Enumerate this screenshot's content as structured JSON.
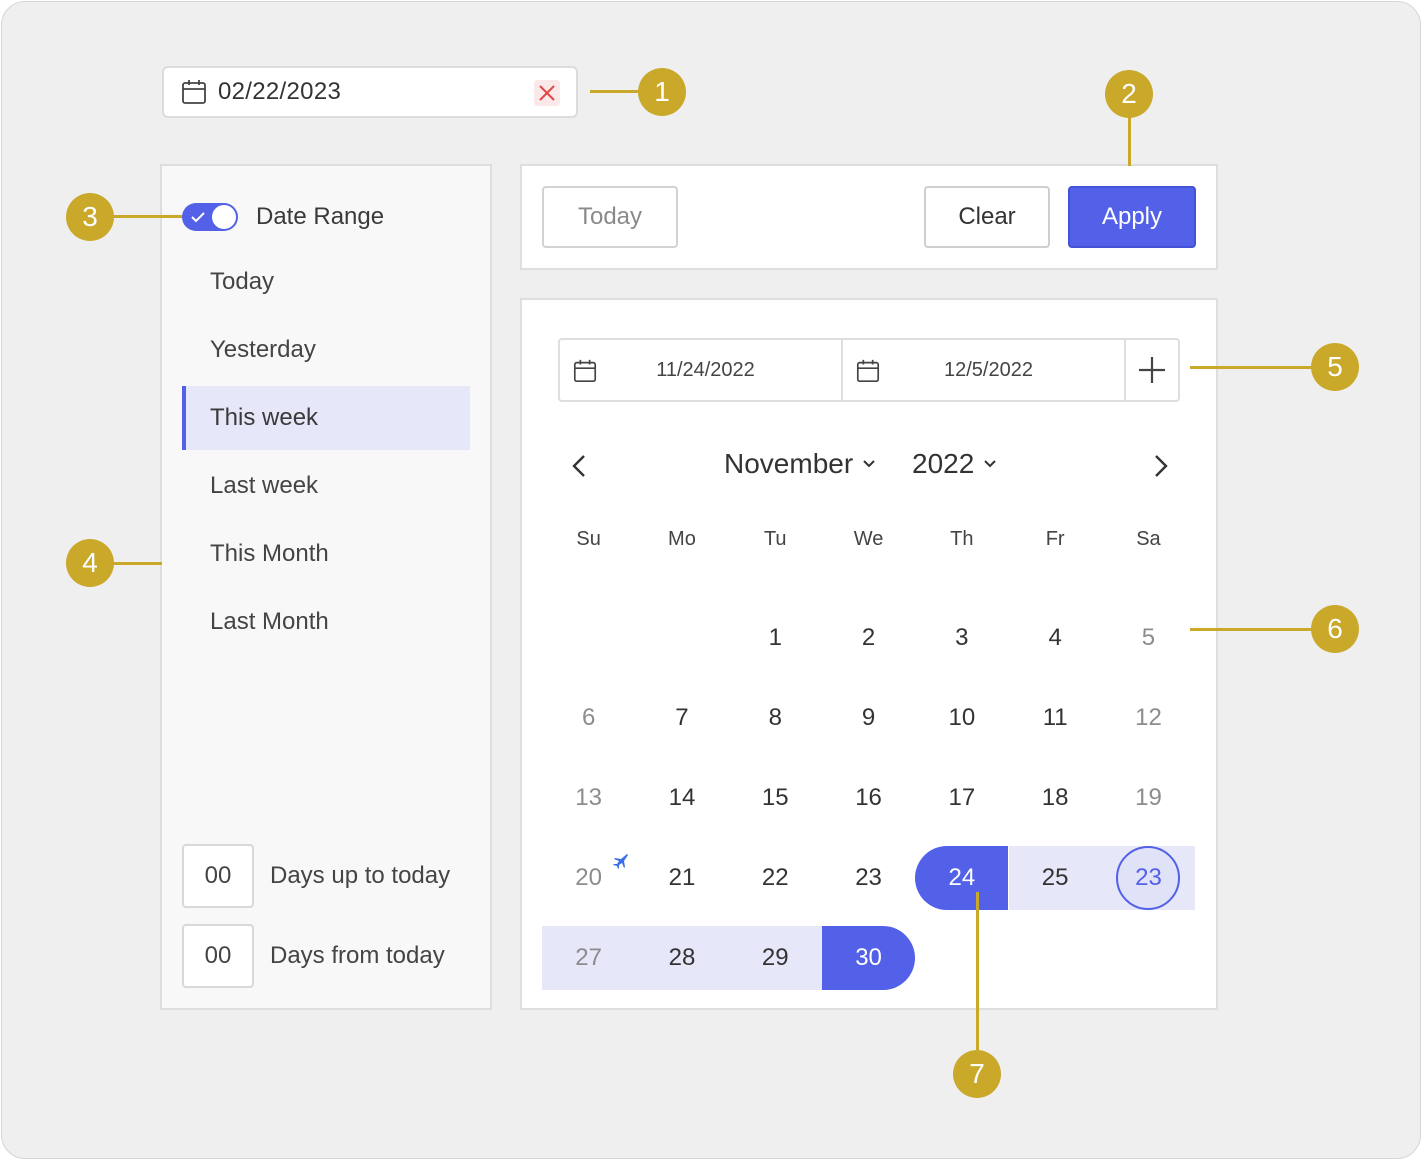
{
  "date_input": {
    "value": "02/22/2023",
    "icon": "calendar-icon",
    "clear_icon": "close-icon"
  },
  "sidebar": {
    "toggle_label": "Date Range",
    "toggle_on": true,
    "items": [
      {
        "label": "Today",
        "active": false
      },
      {
        "label": "Yesterday",
        "active": false
      },
      {
        "label": "This week",
        "active": true
      },
      {
        "label": "Last week",
        "active": false
      },
      {
        "label": "This Month",
        "active": false
      },
      {
        "label": "Last Month",
        "active": false
      }
    ],
    "days_up": {
      "value": "00",
      "label": "Days up to today"
    },
    "days_from": {
      "value": "00",
      "label": "Days from today"
    }
  },
  "actions": {
    "today": "Today",
    "clear": "Clear",
    "apply": "Apply"
  },
  "range": {
    "start": "11/24/2022",
    "end": "12/5/2022",
    "add_icon": "plus-icon"
  },
  "calendar": {
    "month": "November",
    "year": "2022",
    "weekdays": [
      "Su",
      "Mo",
      "Tu",
      "We",
      "Th",
      "Fr",
      "Sa"
    ],
    "weeks": [
      [
        "",
        "",
        "1",
        "2",
        "3",
        "4",
        "5"
      ],
      [
        "6",
        "7",
        "8",
        "9",
        "10",
        "11",
        "12"
      ],
      [
        "13",
        "14",
        "15",
        "16",
        "17",
        "18",
        "19"
      ],
      [
        "20",
        "21",
        "22",
        "23",
        "24",
        "25",
        "23"
      ],
      [
        "27",
        "28",
        "29",
        "30",
        "",
        "",
        ""
      ]
    ],
    "range_start": "24",
    "range_end": "30",
    "today_marker": "23",
    "holiday_marker": "20"
  },
  "callouts": [
    "1",
    "2",
    "3",
    "4",
    "5",
    "6",
    "7"
  ],
  "colors": {
    "accent": "#5360e8",
    "range_bg": "#e6e7f8",
    "callout": "#c9a82a"
  }
}
